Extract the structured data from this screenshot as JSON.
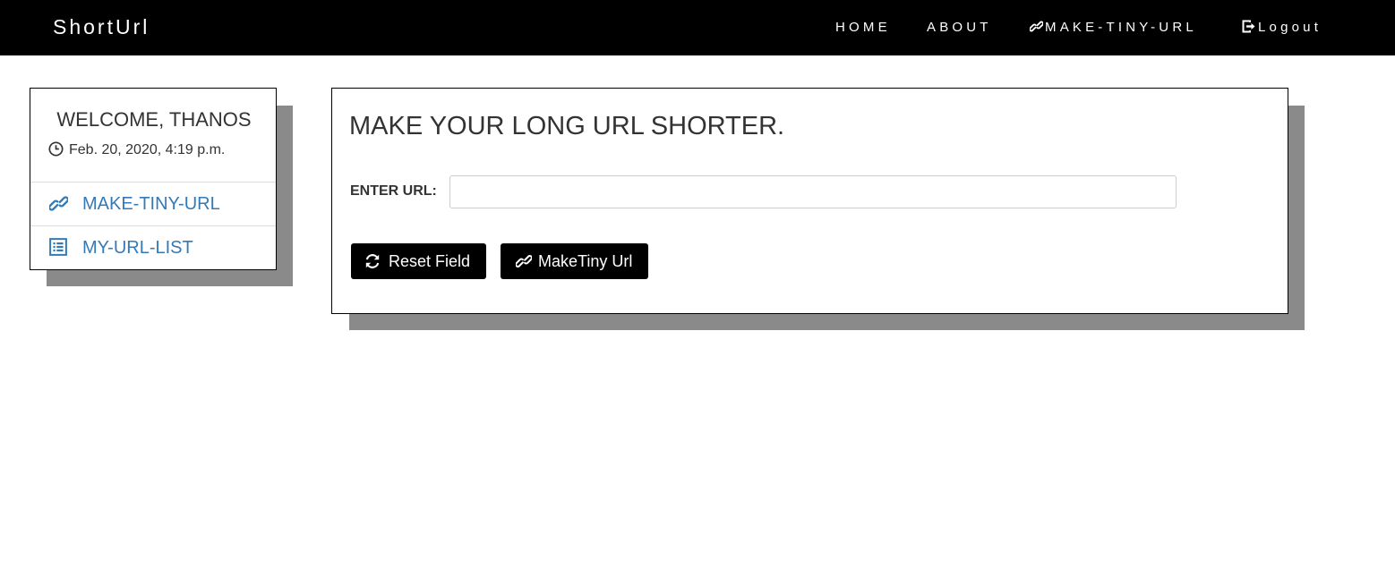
{
  "navbar": {
    "brand": "ShortUrl",
    "links": [
      {
        "label": "HOME"
      },
      {
        "label": "ABOUT"
      },
      {
        "label": "MAKE-TINY-URL",
        "icon": "link-icon"
      },
      {
        "label": "Logout",
        "icon": "logout-icon"
      }
    ]
  },
  "sidebar": {
    "welcome": "WELCOME,  THANOS",
    "datetime": "Feb. 20, 2020, 4:19 p.m.",
    "datetime_icon": "clock-icon",
    "items": [
      {
        "label": "MAKE-TINY-URL",
        "icon": "link-icon"
      },
      {
        "label": "MY-URL-LIST",
        "icon": "list-icon"
      }
    ]
  },
  "main": {
    "title": "MAKE YOUR LONG URL SHORTER.",
    "url_label": "ENTER URL:",
    "url_value": "",
    "reset_label": "Reset Field",
    "make_label": "MakeTiny Url"
  },
  "colors": {
    "navbar_bg": "#000000",
    "link_color": "#337ab7",
    "shadow": "#8a8a8a",
    "button_bg": "#000000"
  }
}
